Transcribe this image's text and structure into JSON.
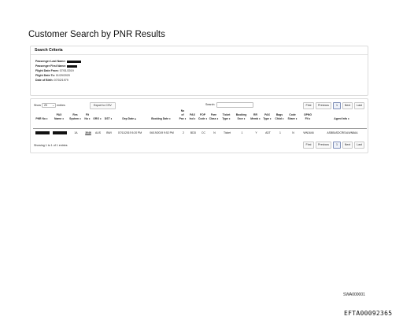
{
  "page_title": "Customer Search by PNR Results",
  "criteria": {
    "title": "Search Criteria",
    "fields": [
      {
        "label": "Passenger Last Name:",
        "value": "",
        "redacted": true
      },
      {
        "label": "Passenger First Name:",
        "value": "",
        "redacted": true
      },
      {
        "label": "Flight Date From:",
        "value": "07/01/2019",
        "redacted": false
      },
      {
        "label": "Flight Date To:",
        "value": "01/29/2020",
        "redacted": false
      },
      {
        "label": "Date of Birth:",
        "value": "07/02/1979",
        "redacted": false
      }
    ]
  },
  "controls": {
    "show_label": "Show",
    "entries_value": "25",
    "entries_label": "entries",
    "export_label": "Export to CSV",
    "search_label": "Search:",
    "search_value": "",
    "pager": [
      "First",
      "Previous",
      "1",
      "Next",
      "Last"
    ]
  },
  "table": {
    "header_lines": [
      {
        "l1": "",
        "l2": "",
        "l3": "PNR No ♦"
      },
      {
        "l1": "",
        "l2": "PAX",
        "l3": "Name ♦"
      },
      {
        "l1": "",
        "l2": "Res",
        "l3": "System ♦"
      },
      {
        "l1": "",
        "l2": "Flt",
        "l3": "No ♦"
      },
      {
        "l1": "",
        "l2": "",
        "l3": "ORG ♦"
      },
      {
        "l1": "",
        "l2": "",
        "l3": "DST ♦"
      },
      {
        "l1": "",
        "l2": "",
        "l3": "Dep Date ▴"
      },
      {
        "l1": "",
        "l2": "",
        "l3": "Booking Date ♦"
      },
      {
        "l1": "No",
        "l2": "of",
        "l3": "Pax ♦"
      },
      {
        "l1": "",
        "l2": "PAX",
        "l3": "Ind ♦"
      },
      {
        "l1": "",
        "l2": "FOP",
        "l3": "Code ♦"
      },
      {
        "l1": "",
        "l2": "Fare",
        "l3": "Class ♦"
      },
      {
        "l1": "",
        "l2": "Ticket",
        "l3": "Type ♦"
      },
      {
        "l1": "",
        "l2": "Booking",
        "l3": "Srce ♦"
      },
      {
        "l1": "",
        "l2": "RR",
        "l3": "Memb ♦"
      },
      {
        "l1": "",
        "l2": "PAX",
        "l3": "Type ♦"
      },
      {
        "l1": "",
        "l2": "Bags",
        "l3": "Chkd ♦"
      },
      {
        "l1": "",
        "l2": "Code",
        "l3": "Share ♦"
      },
      {
        "l1": "",
        "l2": "OPNG",
        "l3": "Flt ♦"
      },
      {
        "l1": "",
        "l2": "",
        "l3": "Agent Info ♦"
      }
    ],
    "rows": [
      [
        "",
        "",
        "1A",
        "3046",
        "AUS",
        "BWI",
        "07/11/2019 5:20 PM",
        "06/19/2019 9:52 PM",
        "2",
        "BDD",
        "CC",
        "N",
        "Ticket",
        "1",
        "Y",
        "ADT",
        "1",
        "N",
        "WN1646",
        "ASBBASDCREALWN8AA"
      ]
    ]
  },
  "info_text": "Showing 1 to 1 of 1 entries",
  "footer_code": "SWA000001",
  "efta_label": "EFTA00092365"
}
